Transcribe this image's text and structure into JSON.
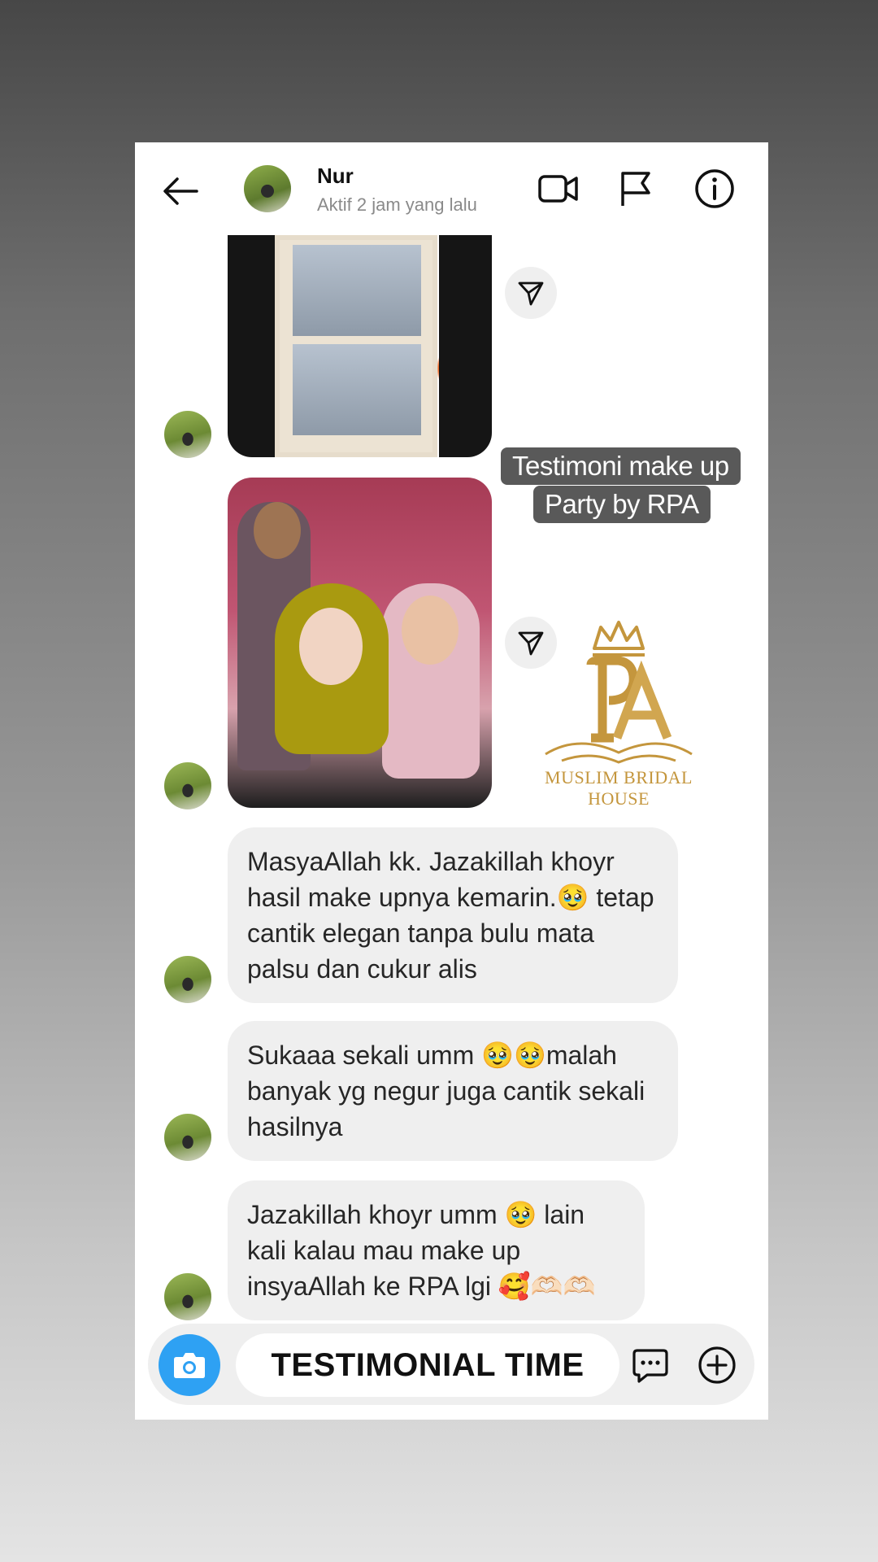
{
  "header": {
    "contact_name": "Nur",
    "status": "Aktif 2 jam yang lalu"
  },
  "icons": [
    "back-arrow-icon",
    "video-call-icon",
    "flag-icon",
    "info-icon",
    "send-share-icon",
    "camera-icon",
    "sticker-chat-icon",
    "plus-circle-icon"
  ],
  "overlay": {
    "caption_line1": "Testimoni make up",
    "caption_line2": "Party by RPA",
    "logo_text": "MUSLIM BRIDAL HOUSE"
  },
  "messages": [
    {
      "text": "MasyaAllah kk. Jazakillah khoyr hasil make upnya kemarin.🥹 tetap cantik elegan tanpa bulu mata palsu dan cukur alis"
    },
    {
      "text": "Sukaaa sekali umm 🥹🥹malah banyak yg negur juga cantik sekali hasilnya"
    },
    {
      "text": "Jazakillah khoyr umm 🥹 lain kali kalau mau make up insyaAllah ke RPA lgi 🥰🫶🏻🫶🏻"
    }
  ],
  "composer": {
    "input_text": "TESTIMONIAL TIME"
  },
  "colors": {
    "accent_blue": "#2ea1f3",
    "bubble_gray": "#efefef",
    "logo_gold": "#c4963d"
  }
}
